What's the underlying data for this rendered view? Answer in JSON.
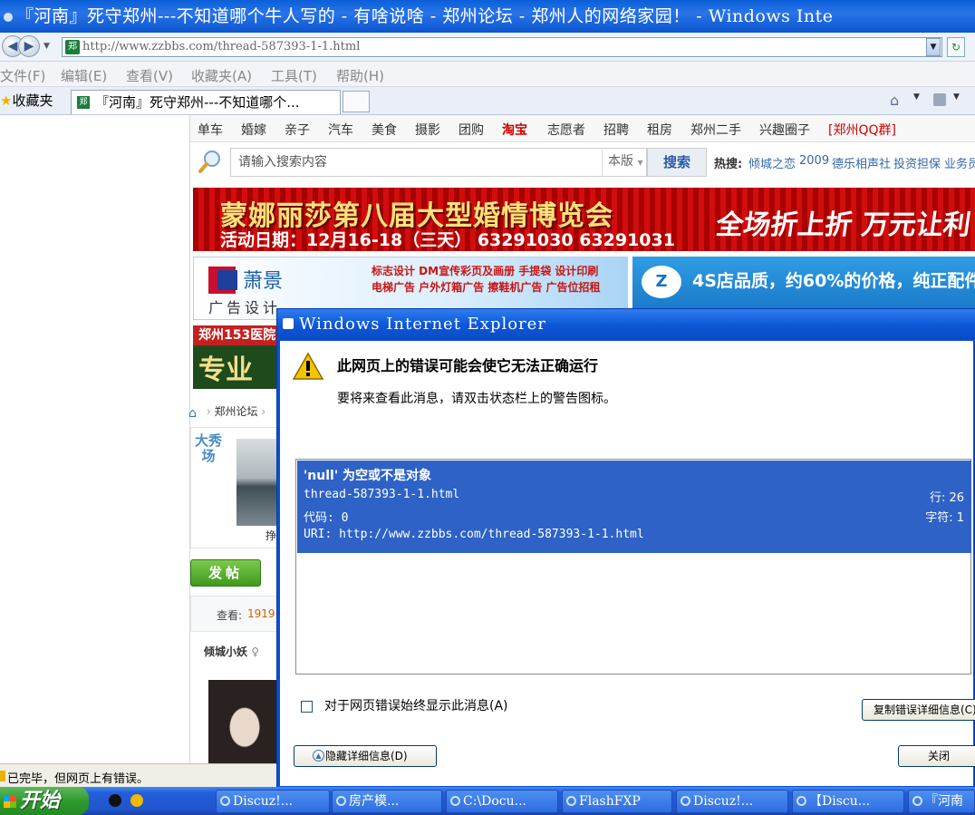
{
  "browser": {
    "window_title": "『河南』死守郑州---不知道哪个牛人写的 - 有啥说啥 - 郑州论坛 - 郑州人的网络家园！ - Windows Inte",
    "address": "http://www.zzbbs.com/thread-587393-1-1.html",
    "menu": [
      "文件(F)",
      "编辑(E)",
      "查看(V)",
      "收藏夹(A)",
      "工具(T)",
      "帮助(H)"
    ],
    "favorites_label": "收藏夹",
    "tab_title": "『河南』死守郑州---不知道哪个...",
    "site_icon_text": "郑"
  },
  "page": {
    "nav_links": [
      "单车",
      "婚嫁",
      "亲子",
      "汽车",
      "美食",
      "摄影",
      "团购",
      "淘宝",
      "志愿者",
      "招聘",
      "租房",
      "郑州二手",
      "兴趣圈子",
      "[郑州QQ群]"
    ],
    "search": {
      "placeholder": "请输入搜索内容",
      "scope": "本版",
      "button": "搜索"
    },
    "hot": {
      "label": "热搜:",
      "items": [
        "倾城之恋",
        "2009",
        "德乐相声社",
        "投资担保",
        "业务员"
      ]
    },
    "banner1": {
      "title": "蒙娜丽莎第八届大型婚情博览会",
      "date": "活动日期：12月16-18（三天） 63291030 63291031",
      "sale": "全场折上折  万元让利"
    },
    "banner2": {
      "brand": "萧景",
      "sub": "广告设计",
      "services1": "标志设计 DM宣传彩页及画册 手提袋 设计印刷",
      "services2": "电梯广告 户外灯箱广告 擦鞋机广告 广告位招租"
    },
    "banner3": {
      "logo": "Z",
      "slogan": "4S店品质，约60%的价格，纯正配件"
    },
    "banner4": {
      "top": "郑州153医院",
      "big": "专业"
    },
    "breadcrumb": "郑州论坛",
    "show": {
      "label": "大秀场",
      "caption": "挣"
    },
    "post_button": "发帖",
    "views_label": "查看:",
    "views_count": "1919",
    "author": "倾城小妖",
    "author_gender": "♀"
  },
  "dialog": {
    "title": "Windows Internet Explorer",
    "heading": "此网页上的错误可能会使它无法正确运行",
    "hint": "要将来查看此消息，请双击状态栏上的警告图标。",
    "error": {
      "message": "'null' 为空或不是对象",
      "file": "thread-587393-1-1.html",
      "code": "代码: 0",
      "uri": "URI: http://www.zzbbs.com/thread-587393-1-1.html",
      "line": "行: 26",
      "char": "字符: 1"
    },
    "always_show_label": "对于网页错误始终显示此消息(A)",
    "copy_button": "复制错误详细信息(C)",
    "hide_button": "隐藏详细信息(D)",
    "close_button": "关闭"
  },
  "status_text": "已完毕，但网页上有错误。",
  "taskbar": {
    "start": "开始",
    "tasks": [
      "Discuz!...",
      "房产模...",
      "C:\\Docu...",
      "FlashFXP",
      "Discuz!...",
      "【Discu...",
      "『河南"
    ]
  }
}
